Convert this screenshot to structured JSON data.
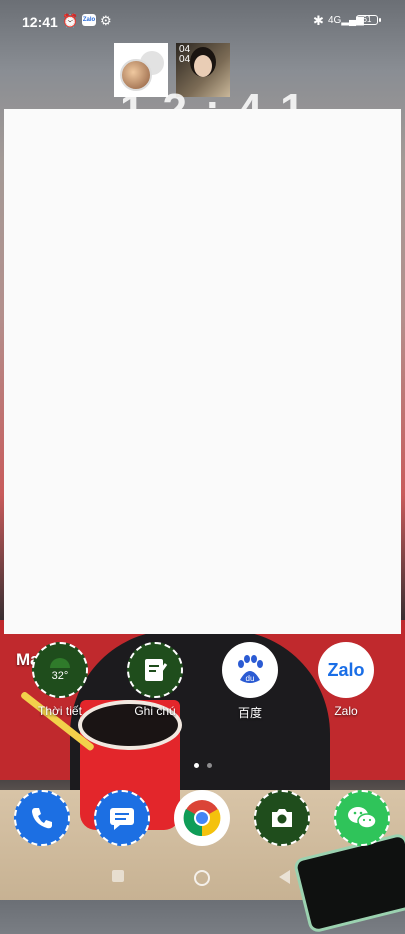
{
  "status_bar": {
    "time": "12:41",
    "zalo_badge": "Zalo",
    "network": "4G",
    "battery": "61"
  },
  "recents": {
    "photo_date_line1": "04",
    "photo_date_line2": "04"
  },
  "clock_peek": "12:41",
  "home": {
    "manage_label": "Manage",
    "apps": [
      {
        "label": "Thời tiết",
        "icon": "weather-icon",
        "temp": "32°"
      },
      {
        "label": "Ghi chú",
        "icon": "notes-icon"
      },
      {
        "label": "百度",
        "icon": "baidu-icon"
      },
      {
        "label": "Zalo",
        "icon": "zalo-icon",
        "icon_text": "Zalo"
      }
    ],
    "dock": [
      {
        "icon": "phone-icon"
      },
      {
        "icon": "messages-icon"
      },
      {
        "icon": "chrome-icon"
      },
      {
        "icon": "camera-icon"
      },
      {
        "icon": "wechat-icon"
      }
    ],
    "page_count": 2,
    "active_page": 1
  },
  "colors": {
    "accent_blue": "#1c6fe3",
    "icon_green": "#1f4d1c",
    "wechat_green": "#2fc45a"
  }
}
